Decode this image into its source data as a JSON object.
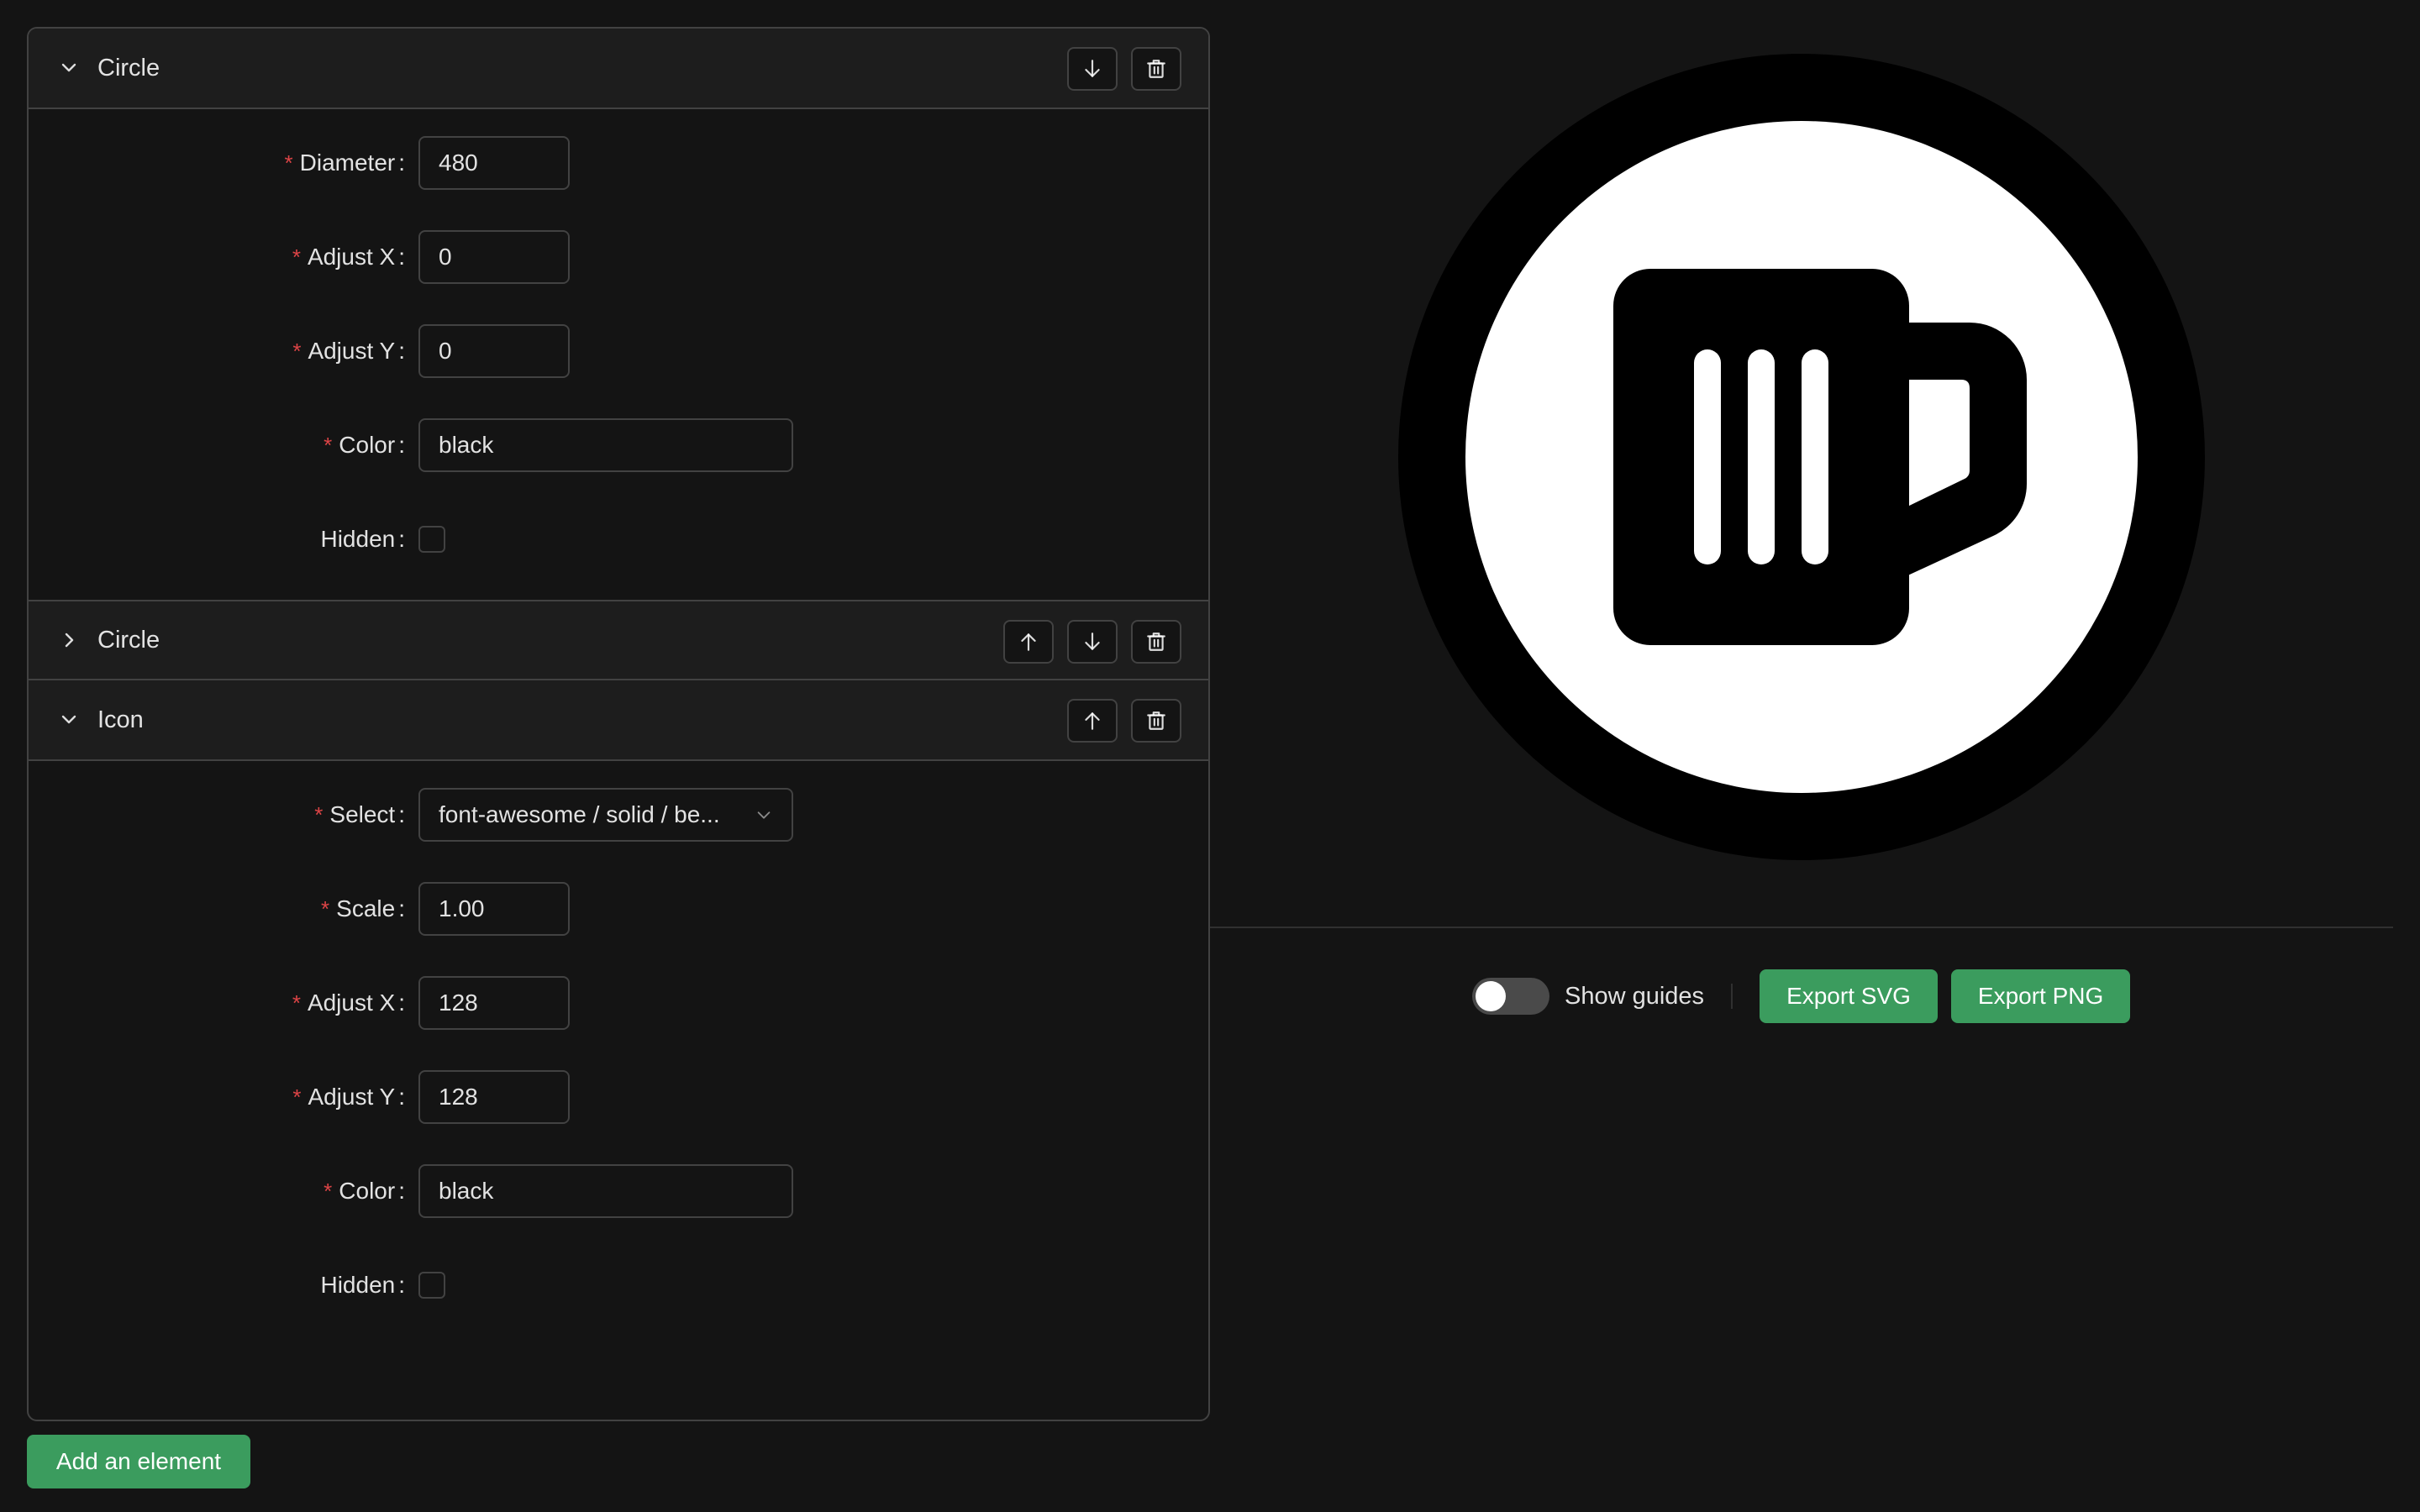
{
  "editor": {
    "panels": [
      {
        "title": "Circle",
        "expanded": true,
        "actions": [
          "move-down",
          "delete"
        ],
        "fields": {
          "diameter": {
            "label": "Diameter",
            "value": "480"
          },
          "adjust_x": {
            "label": "Adjust X",
            "value": "0"
          },
          "adjust_y": {
            "label": "Adjust Y",
            "value": "0"
          },
          "color": {
            "label": "Color",
            "value": "black"
          },
          "hidden": {
            "label": "Hidden",
            "checked": false
          }
        }
      },
      {
        "title": "Circle",
        "expanded": false,
        "actions": [
          "move-up",
          "move-down",
          "delete"
        ]
      },
      {
        "title": "Icon",
        "expanded": true,
        "actions": [
          "move-up",
          "delete"
        ],
        "fields": {
          "select": {
            "label": "Select",
            "value": "font-awesome / solid / be..."
          },
          "scale": {
            "label": "Scale",
            "value": "1.00"
          },
          "adjust_x": {
            "label": "Adjust X",
            "value": "128"
          },
          "adjust_y": {
            "label": "Adjust Y",
            "value": "128"
          },
          "color": {
            "label": "Color",
            "value": "black"
          },
          "hidden": {
            "label": "Hidden",
            "checked": false
          }
        }
      }
    ],
    "add_button": "Add an element"
  },
  "preview": {
    "icon": "beer-mug-icon",
    "outer_circle_color": "#000000",
    "inner_circle_color": "#ffffff",
    "icon_color": "#000000"
  },
  "toolbar": {
    "show_guides_label": "Show guides",
    "show_guides_on": false,
    "export_svg": "Export SVG",
    "export_png": "Export PNG"
  },
  "colors": {
    "background": "#141414",
    "accent": "#3b9c5e",
    "required": "#dc4446",
    "border": "#424242"
  }
}
